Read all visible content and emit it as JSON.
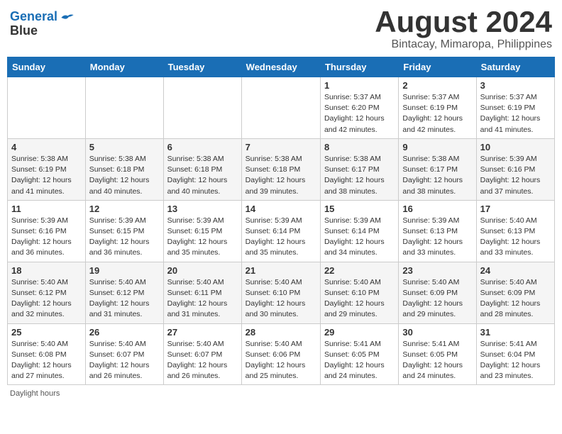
{
  "header": {
    "logo_line1": "General",
    "logo_line2": "Blue",
    "title": "August 2024",
    "subtitle": "Bintacay, Mimaropa, Philippines"
  },
  "days_of_week": [
    "Sunday",
    "Monday",
    "Tuesday",
    "Wednesday",
    "Thursday",
    "Friday",
    "Saturday"
  ],
  "weeks": [
    [
      {
        "num": "",
        "info": ""
      },
      {
        "num": "",
        "info": ""
      },
      {
        "num": "",
        "info": ""
      },
      {
        "num": "",
        "info": ""
      },
      {
        "num": "1",
        "info": "Sunrise: 5:37 AM\nSunset: 6:20 PM\nDaylight: 12 hours and 42 minutes."
      },
      {
        "num": "2",
        "info": "Sunrise: 5:37 AM\nSunset: 6:19 PM\nDaylight: 12 hours and 42 minutes."
      },
      {
        "num": "3",
        "info": "Sunrise: 5:37 AM\nSunset: 6:19 PM\nDaylight: 12 hours and 41 minutes."
      }
    ],
    [
      {
        "num": "4",
        "info": "Sunrise: 5:38 AM\nSunset: 6:19 PM\nDaylight: 12 hours and 41 minutes."
      },
      {
        "num": "5",
        "info": "Sunrise: 5:38 AM\nSunset: 6:18 PM\nDaylight: 12 hours and 40 minutes."
      },
      {
        "num": "6",
        "info": "Sunrise: 5:38 AM\nSunset: 6:18 PM\nDaylight: 12 hours and 40 minutes."
      },
      {
        "num": "7",
        "info": "Sunrise: 5:38 AM\nSunset: 6:18 PM\nDaylight: 12 hours and 39 minutes."
      },
      {
        "num": "8",
        "info": "Sunrise: 5:38 AM\nSunset: 6:17 PM\nDaylight: 12 hours and 38 minutes."
      },
      {
        "num": "9",
        "info": "Sunrise: 5:38 AM\nSunset: 6:17 PM\nDaylight: 12 hours and 38 minutes."
      },
      {
        "num": "10",
        "info": "Sunrise: 5:39 AM\nSunset: 6:16 PM\nDaylight: 12 hours and 37 minutes."
      }
    ],
    [
      {
        "num": "11",
        "info": "Sunrise: 5:39 AM\nSunset: 6:16 PM\nDaylight: 12 hours and 36 minutes."
      },
      {
        "num": "12",
        "info": "Sunrise: 5:39 AM\nSunset: 6:15 PM\nDaylight: 12 hours and 36 minutes."
      },
      {
        "num": "13",
        "info": "Sunrise: 5:39 AM\nSunset: 6:15 PM\nDaylight: 12 hours and 35 minutes."
      },
      {
        "num": "14",
        "info": "Sunrise: 5:39 AM\nSunset: 6:14 PM\nDaylight: 12 hours and 35 minutes."
      },
      {
        "num": "15",
        "info": "Sunrise: 5:39 AM\nSunset: 6:14 PM\nDaylight: 12 hours and 34 minutes."
      },
      {
        "num": "16",
        "info": "Sunrise: 5:39 AM\nSunset: 6:13 PM\nDaylight: 12 hours and 33 minutes."
      },
      {
        "num": "17",
        "info": "Sunrise: 5:40 AM\nSunset: 6:13 PM\nDaylight: 12 hours and 33 minutes."
      }
    ],
    [
      {
        "num": "18",
        "info": "Sunrise: 5:40 AM\nSunset: 6:12 PM\nDaylight: 12 hours and 32 minutes."
      },
      {
        "num": "19",
        "info": "Sunrise: 5:40 AM\nSunset: 6:12 PM\nDaylight: 12 hours and 31 minutes."
      },
      {
        "num": "20",
        "info": "Sunrise: 5:40 AM\nSunset: 6:11 PM\nDaylight: 12 hours and 31 minutes."
      },
      {
        "num": "21",
        "info": "Sunrise: 5:40 AM\nSunset: 6:10 PM\nDaylight: 12 hours and 30 minutes."
      },
      {
        "num": "22",
        "info": "Sunrise: 5:40 AM\nSunset: 6:10 PM\nDaylight: 12 hours and 29 minutes."
      },
      {
        "num": "23",
        "info": "Sunrise: 5:40 AM\nSunset: 6:09 PM\nDaylight: 12 hours and 29 minutes."
      },
      {
        "num": "24",
        "info": "Sunrise: 5:40 AM\nSunset: 6:09 PM\nDaylight: 12 hours and 28 minutes."
      }
    ],
    [
      {
        "num": "25",
        "info": "Sunrise: 5:40 AM\nSunset: 6:08 PM\nDaylight: 12 hours and 27 minutes."
      },
      {
        "num": "26",
        "info": "Sunrise: 5:40 AM\nSunset: 6:07 PM\nDaylight: 12 hours and 26 minutes."
      },
      {
        "num": "27",
        "info": "Sunrise: 5:40 AM\nSunset: 6:07 PM\nDaylight: 12 hours and 26 minutes."
      },
      {
        "num": "28",
        "info": "Sunrise: 5:40 AM\nSunset: 6:06 PM\nDaylight: 12 hours and 25 minutes."
      },
      {
        "num": "29",
        "info": "Sunrise: 5:41 AM\nSunset: 6:05 PM\nDaylight: 12 hours and 24 minutes."
      },
      {
        "num": "30",
        "info": "Sunrise: 5:41 AM\nSunset: 6:05 PM\nDaylight: 12 hours and 24 minutes."
      },
      {
        "num": "31",
        "info": "Sunrise: 5:41 AM\nSunset: 6:04 PM\nDaylight: 12 hours and 23 minutes."
      }
    ]
  ],
  "footer": {
    "daylight_label": "Daylight hours"
  }
}
